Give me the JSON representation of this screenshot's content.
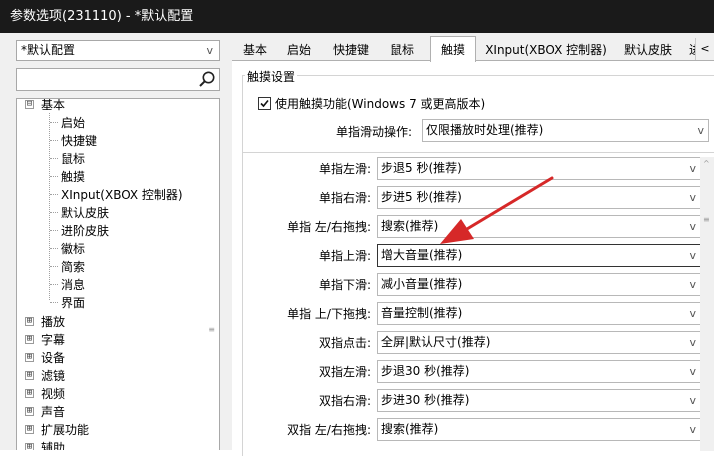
{
  "window": {
    "title": "参数选项(231110) - *默认配置"
  },
  "sidebar": {
    "preset": "*默认配置",
    "search_placeholder": "",
    "tree": [
      {
        "label": "基本",
        "expander": "⊟"
      },
      {
        "label": "启始"
      },
      {
        "label": "快捷键"
      },
      {
        "label": "鼠标"
      },
      {
        "label": "触摸"
      },
      {
        "label": "XInput(XBOX 控制器)"
      },
      {
        "label": "默认皮肤"
      },
      {
        "label": "进阶皮肤"
      },
      {
        "label": "徽标"
      },
      {
        "label": "简索"
      },
      {
        "label": "消息"
      },
      {
        "label": "界面"
      },
      {
        "label": "播放",
        "expander": "⊞"
      },
      {
        "label": "字幕",
        "expander": "⊞"
      },
      {
        "label": "设备",
        "expander": "⊞"
      },
      {
        "label": "滤镜",
        "expander": "⊞"
      },
      {
        "label": "视频",
        "expander": "⊞"
      },
      {
        "label": "声音",
        "expander": "⊞"
      },
      {
        "label": "扩展功能",
        "expander": "⊞"
      },
      {
        "label": "辅助",
        "expander": "⊞"
      }
    ]
  },
  "tabs": [
    "基本",
    "启始",
    "快捷键",
    "鼠标",
    "触摸",
    "XInput(XBOX 控制器)",
    "默认皮肤",
    "进"
  ],
  "active_tab": "触摸",
  "touch": {
    "group_title": "触摸设置",
    "enable_label": "使用触摸功能(Windows 7 或更高版本)",
    "enable_checked": true,
    "single_swipe_label": "单指滑动操作:",
    "single_swipe_value": "仅限播放时处理(推荐)",
    "settings": [
      {
        "label": "单指左滑:",
        "value": "步退5 秒(推荐)"
      },
      {
        "label": "单指右滑:",
        "value": "步进5 秒(推荐)"
      },
      {
        "label": "单指 左/右拖拽:",
        "value": "搜索(推荐)"
      },
      {
        "label": "单指上滑:",
        "value": "增大音量(推荐)"
      },
      {
        "label": "单指下滑:",
        "value": "减小音量(推荐)"
      },
      {
        "label": "单指 上/下拖拽:",
        "value": "音量控制(推荐)"
      },
      {
        "label": "双指点击:",
        "value": "全屏|默认尺寸(推荐)"
      },
      {
        "label": "双指左滑:",
        "value": "步退30 秒(推荐)"
      },
      {
        "label": "双指右滑:",
        "value": "步进30 秒(推荐)"
      },
      {
        "label": "双指 左/右拖拽:",
        "value": "搜索(推荐)"
      }
    ]
  },
  "icons": {
    "dropdown": "chevron-down-icon",
    "search": "magnifier-icon",
    "annotation": "red-arrow-icon"
  },
  "colors": {
    "titlebar": "#1a1a1a",
    "annotation_arrow": "#d62828"
  }
}
